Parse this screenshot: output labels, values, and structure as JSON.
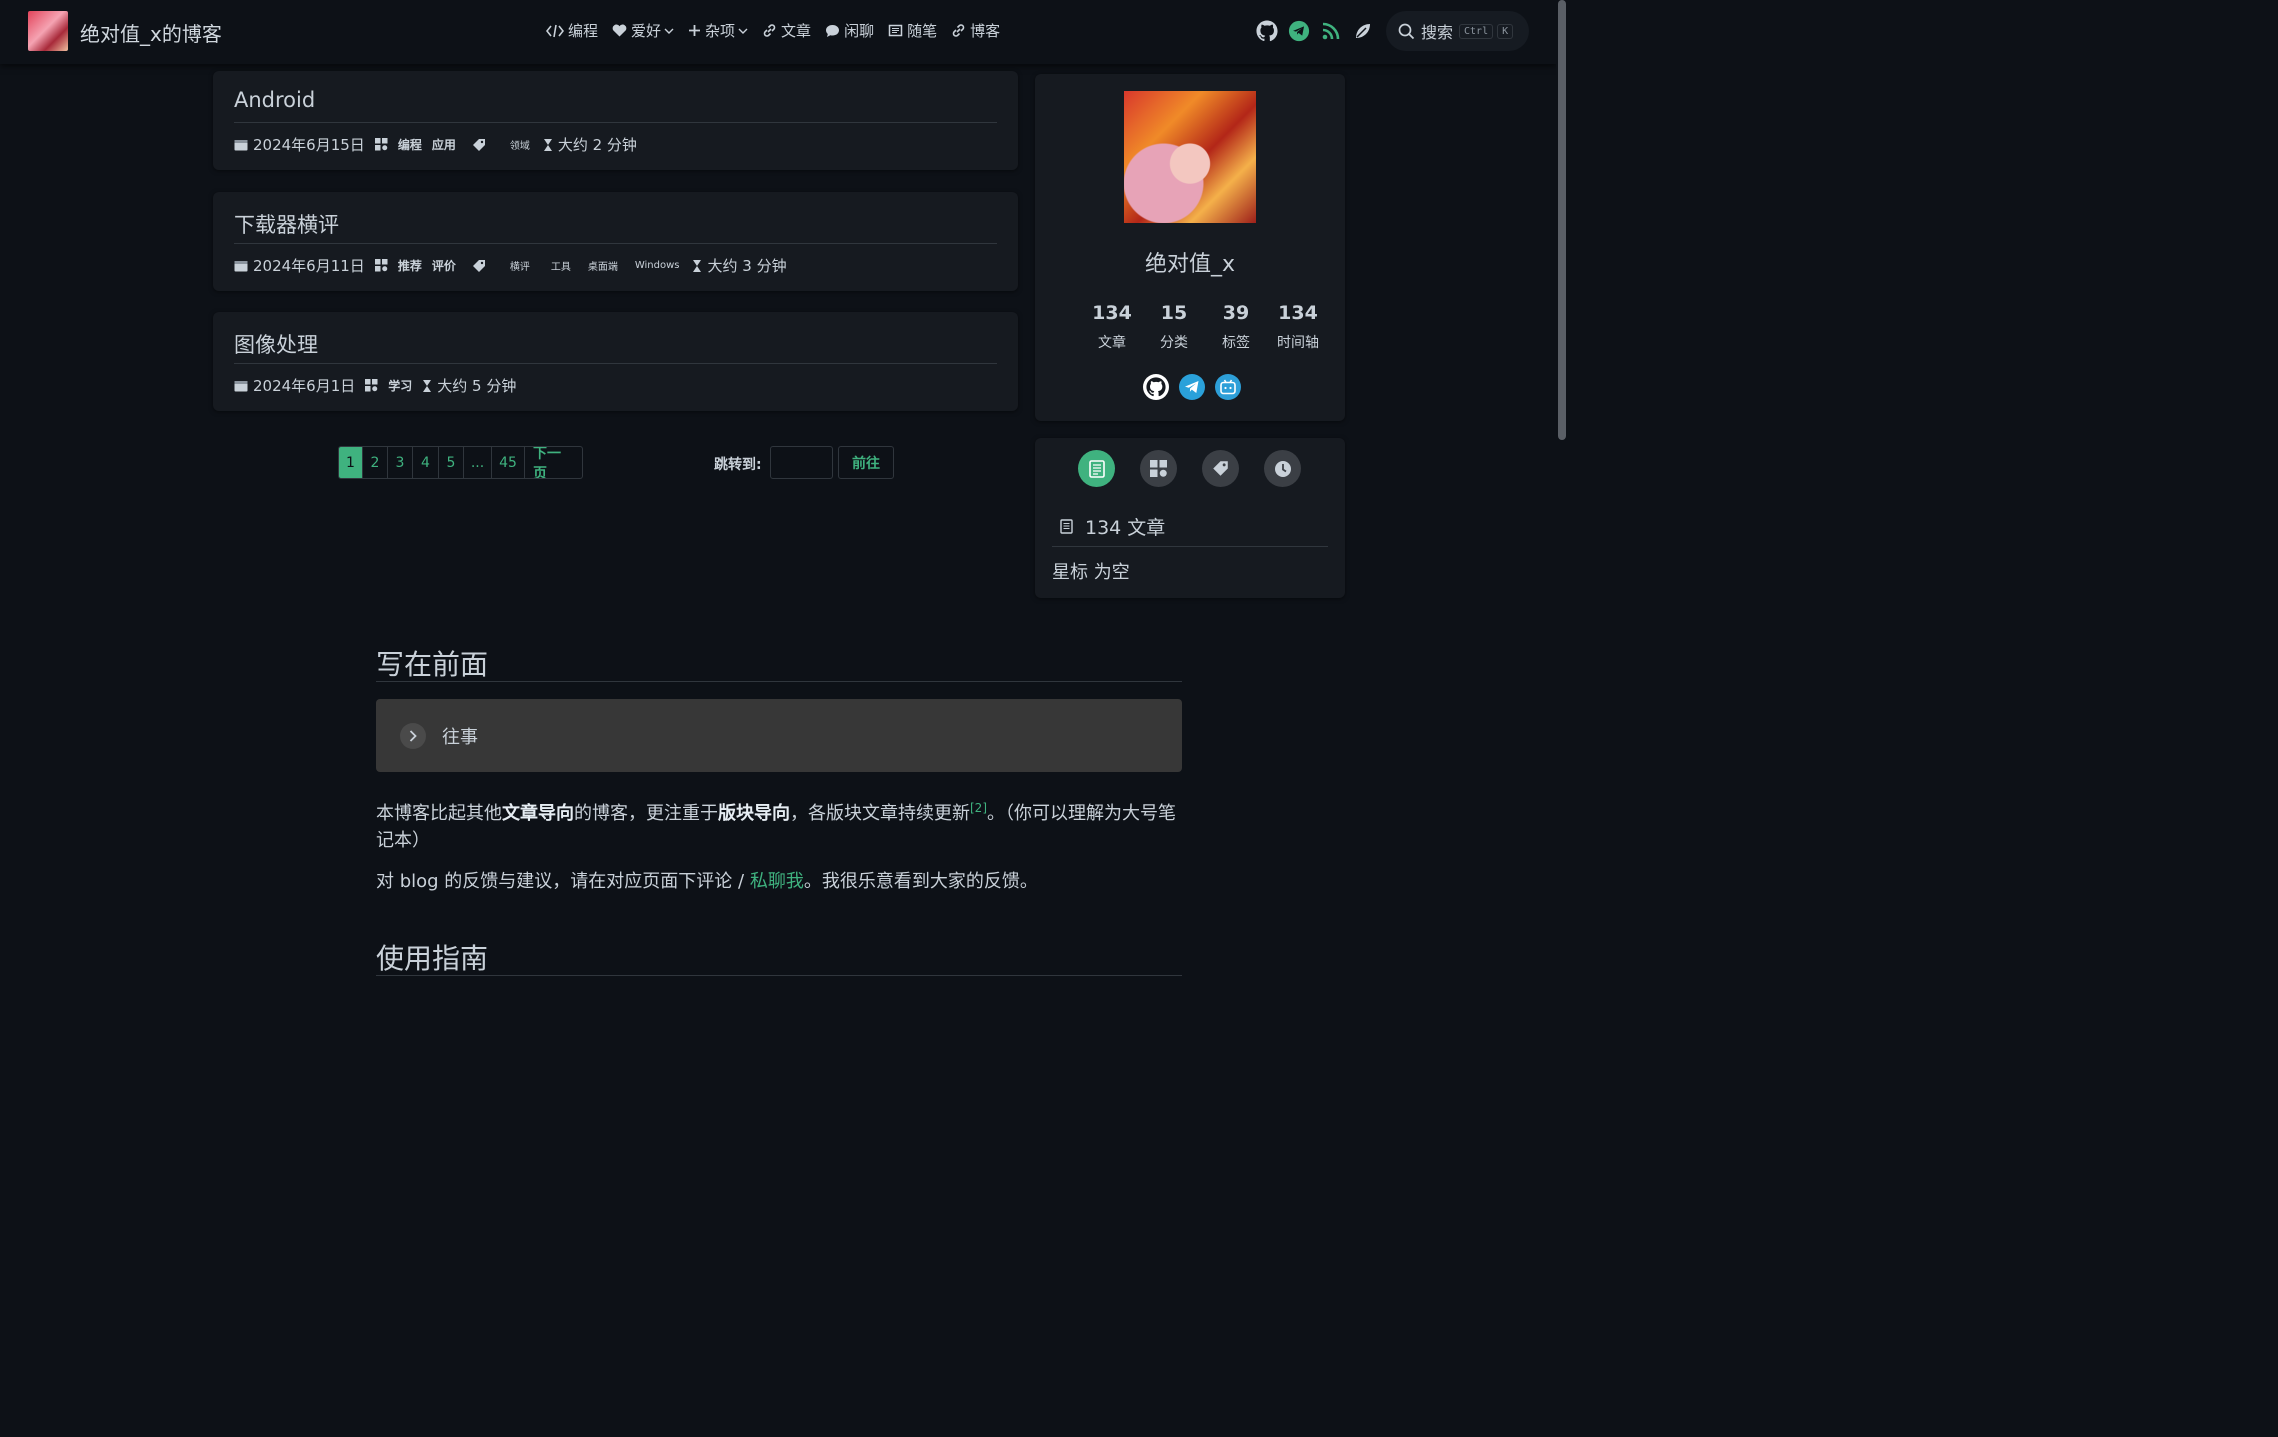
{
  "site": {
    "name": "绝对值_x的博客"
  },
  "nav": {
    "items": [
      {
        "label": "编程",
        "icon": "code-icon"
      },
      {
        "label": "爱好",
        "icon": "heart-icon",
        "dropdown": true
      },
      {
        "label": "杂项",
        "icon": "plus-icon",
        "dropdown": true
      },
      {
        "label": "文章",
        "icon": "link-icon"
      },
      {
        "label": "闲聊",
        "icon": "chat-icon"
      },
      {
        "label": "随笔",
        "icon": "book-icon"
      },
      {
        "label": "博客",
        "icon": "link-icon"
      }
    ],
    "icons": [
      "github-icon",
      "telegram-icon",
      "rss-icon",
      "theme-toggle-icon"
    ],
    "search": {
      "label": "搜索",
      "key1": "Ctrl",
      "key2": "K"
    }
  },
  "articles": [
    {
      "title": "Android",
      "date": "2024年6月15日",
      "categories": [
        "编程",
        "应用"
      ],
      "tags": [
        "领域"
      ],
      "read_time": "大约 2 分钟"
    },
    {
      "title": "下载器横评",
      "date": "2024年6月11日",
      "categories": [
        "推荐",
        "评价"
      ],
      "tags": [
        "横评",
        "工具",
        "桌面端",
        "Windows"
      ],
      "read_time": "大约 3 分钟"
    },
    {
      "title": "图像处理",
      "date": "2024年6月1日",
      "categories": [
        "学习"
      ],
      "tags": [],
      "read_time": "大约 5 分钟"
    }
  ],
  "pagination": {
    "pages": [
      "1",
      "2",
      "3",
      "4",
      "5",
      "...",
      "45"
    ],
    "current": "1",
    "next_label": "下一页",
    "jump_label": "跳转到:",
    "jump_button": "前往"
  },
  "profile": {
    "name": "绝对值_x",
    "stats": [
      {
        "num": "134",
        "label": "文章"
      },
      {
        "num": "15",
        "label": "分类"
      },
      {
        "num": "39",
        "label": "标签"
      },
      {
        "num": "134",
        "label": "时间轴"
      }
    ],
    "socials": [
      "github-icon",
      "telegram-icon",
      "bilibili-icon"
    ]
  },
  "info_panel": {
    "tabs": [
      "article-icon",
      "category-icon",
      "tag-icon",
      "timeline-icon"
    ],
    "count_text": "134 文章",
    "star_text": "星标 为空"
  },
  "content": {
    "heading1": "写在前面",
    "details_label": "往事",
    "para1_a": "本博客比起其他",
    "para1_b": "文章导向",
    "para1_c": "的博客，更注重于",
    "para1_d": "版块导向",
    "para1_e": "，各版块文章持续更新",
    "para1_sup": "[2]",
    "para1_f": "。（你可以理解为大号笔记本）",
    "para2_a": "对 blog 的反馈与建议，请在对应页面下评论 / ",
    "para2_link": "私聊我",
    "para2_b": "。我很乐意看到大家的反馈。",
    "heading2": "使用指南"
  },
  "colors": {
    "accent": "#3fb27f",
    "bg": "#0d1117",
    "card": "#161a20"
  }
}
